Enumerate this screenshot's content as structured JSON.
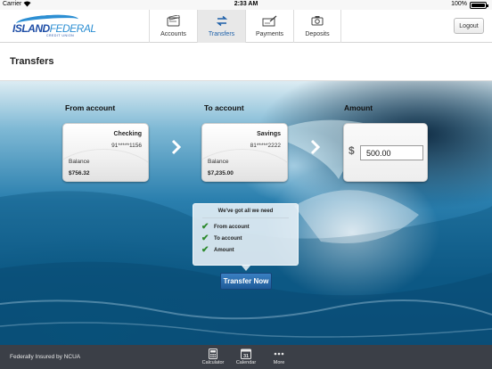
{
  "status_bar": {
    "carrier": "Carrier",
    "time": "2:33 AM",
    "battery": "100%"
  },
  "brand": {
    "name_bold": "ISLAND",
    "name_light": "FEDERAL",
    "tagline": "CREDIT UNION"
  },
  "nav": {
    "tabs": [
      {
        "label": "Accounts",
        "icon": "wallet-icon"
      },
      {
        "label": "Transfers",
        "icon": "transfer-arrows-icon"
      },
      {
        "label": "Payments",
        "icon": "check-pen-icon"
      },
      {
        "label": "Deposits",
        "icon": "camera-icon"
      }
    ],
    "active_tab": "Transfers",
    "logout_label": "Logout"
  },
  "page": {
    "title": "Transfers"
  },
  "transfer": {
    "from_label": "From account",
    "to_label": "To account",
    "amount_label": "Amount",
    "from_account": {
      "type": "Checking",
      "number": "91*****1156",
      "balance_label": "Balance",
      "balance": "$756.32"
    },
    "to_account": {
      "type": "Savings",
      "number": "81*****2222",
      "balance_label": "Balance",
      "balance": "$7,235.00"
    },
    "currency_symbol": "$",
    "amount_value": "500.00"
  },
  "checklist": {
    "heading": "We've got all we need",
    "items": [
      "From account",
      "To account",
      "Amount"
    ]
  },
  "submit_label": "Transfer Now",
  "footer": {
    "insured_text": "Federally Insured by NCUA",
    "buttons": [
      {
        "label": "Calculator",
        "icon": "calculator-icon"
      },
      {
        "label": "Calendar",
        "icon": "calendar-icon",
        "day": "31"
      },
      {
        "label": "More",
        "icon": "more-dots-icon"
      }
    ]
  },
  "colors": {
    "accent": "#1c5fa8",
    "button": "#2a6cb0",
    "footer_bg": "#3b3f47",
    "check": "#2d8a2d"
  }
}
